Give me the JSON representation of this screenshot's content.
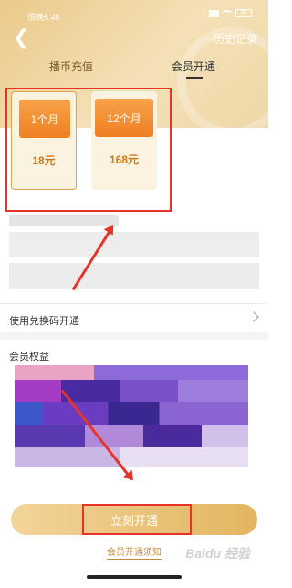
{
  "status": {
    "time": "傍晚6:40",
    "battery": "38"
  },
  "header": {
    "back_icon": "chevron-left-icon",
    "history_label": "历史记录"
  },
  "tabs": [
    {
      "label": "播币充值",
      "active": false
    },
    {
      "label": "会员开通",
      "active": true
    }
  ],
  "plans": [
    {
      "duration": "1个月",
      "price": "18元",
      "selected": true
    },
    {
      "duration": "12个月",
      "price": "168元",
      "selected": false
    }
  ],
  "redeem": {
    "label": "使用兑换码开通"
  },
  "benefits": {
    "title": "会员权益"
  },
  "cta": {
    "label": "立刻开通"
  },
  "notice": {
    "label": "会员开通须知"
  },
  "watermark": {
    "text": "Baidu 经验"
  },
  "colors": {
    "accent": "#e2b560",
    "price": "#c87a1e",
    "annotation": "#e8332a"
  }
}
